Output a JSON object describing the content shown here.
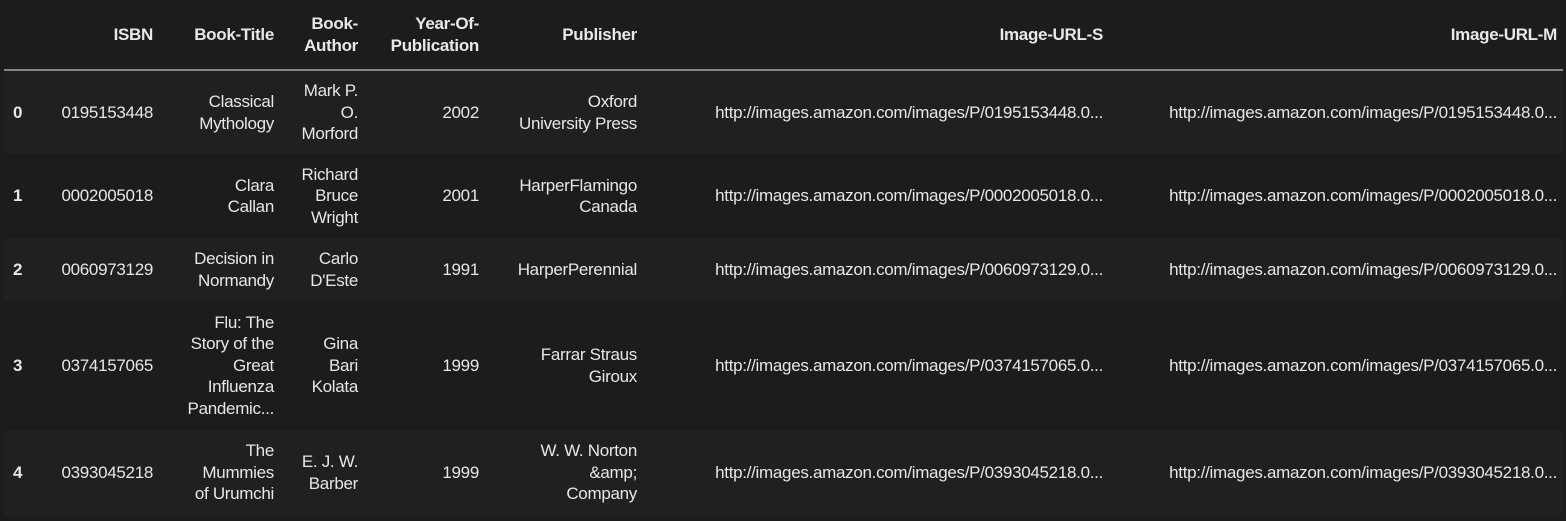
{
  "dataframe": {
    "columns": [
      "",
      "ISBN",
      "Book-Title",
      "Book-Author",
      "Year-Of-Publication",
      "Publisher",
      "Image-URL-S",
      "Image-URL-M"
    ],
    "header_lines": {
      "book_author": [
        "Book-",
        "Author"
      ],
      "year": [
        "Year-Of-",
        "Publication"
      ]
    },
    "rows": [
      {
        "index": "0",
        "isbn": "0195153448",
        "title": [
          "Classical",
          "Mythology"
        ],
        "author": [
          "Mark P.",
          "O.",
          "Morford"
        ],
        "year": "2002",
        "publisher": [
          "Oxford",
          "University Press"
        ],
        "url_s": "http://images.amazon.com/images/P/0195153448.0...",
        "url_m": "http://images.amazon.com/images/P/0195153448.0..."
      },
      {
        "index": "1",
        "isbn": "0002005018",
        "title": [
          "Clara",
          "Callan"
        ],
        "author": [
          "Richard",
          "Bruce",
          "Wright"
        ],
        "year": "2001",
        "publisher": [
          "HarperFlamingo",
          "Canada"
        ],
        "url_s": "http://images.amazon.com/images/P/0002005018.0...",
        "url_m": "http://images.amazon.com/images/P/0002005018.0..."
      },
      {
        "index": "2",
        "isbn": "0060973129",
        "title": [
          "Decision in",
          "Normandy"
        ],
        "author": [
          "Carlo",
          "D'Este"
        ],
        "year": "1991",
        "publisher": [
          "HarperPerennial"
        ],
        "url_s": "http://images.amazon.com/images/P/0060973129.0...",
        "url_m": "http://images.amazon.com/images/P/0060973129.0..."
      },
      {
        "index": "3",
        "isbn": "0374157065",
        "title": [
          "Flu: The",
          "Story of the",
          "Great",
          "Influenza",
          "Pandemic..."
        ],
        "author": [
          "Gina",
          "Bari",
          "Kolata"
        ],
        "year": "1999",
        "publisher": [
          "Farrar Straus",
          "Giroux"
        ],
        "url_s": "http://images.amazon.com/images/P/0374157065.0...",
        "url_m": "http://images.amazon.com/images/P/0374157065.0..."
      },
      {
        "index": "4",
        "isbn": "0393045218",
        "title": [
          "The",
          "Mummies",
          "of Urumchi"
        ],
        "author": [
          "E. J. W.",
          "Barber"
        ],
        "year": "1999",
        "publisher": [
          "W. W. Norton",
          "&amp;",
          "Company"
        ],
        "url_s": "http://images.amazon.com/images/P/0393045218.0...",
        "url_m": "http://images.amazon.com/images/P/0393045218.0..."
      }
    ]
  },
  "colors": {
    "background": "#1b1c1e",
    "stripe": "#1f2022",
    "header_rule": "#8e8579",
    "text": "#e6e6e6"
  }
}
